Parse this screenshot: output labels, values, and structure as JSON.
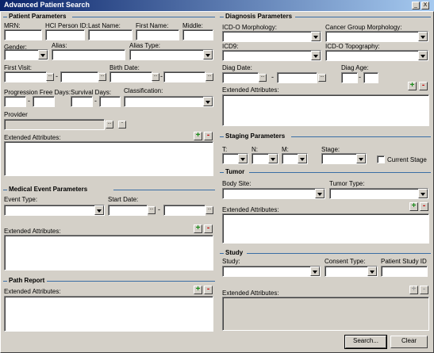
{
  "window": {
    "title": "Advanced Patient Search",
    "minimize_label": "_",
    "close_label": "X"
  },
  "patient": {
    "title": "Patient Parameters",
    "mrn": "MRN:",
    "hci_person_id": "HCI Person ID:",
    "last_name": "Last Name:",
    "first_name": "First Name:",
    "middle": "Middle:",
    "gender": "Gender:",
    "alias": "Alias:",
    "alias_type": "Alias Type:",
    "first_visit": "First Visit:",
    "birth_date": "Birth Date:",
    "progression_free_days": "Progression Free Days:",
    "survival_days": "Survival Days:",
    "classification": "Classification:",
    "provider": "Provider",
    "extended_attributes": "Extended Attributes:"
  },
  "medical_event": {
    "title": "Medical Event Parameters",
    "event_type": "Event Type:",
    "start_date": "Start Date:",
    "extended_attributes": "Extended Attributes:"
  },
  "path_report": {
    "title": "Path Report",
    "extended_attributes": "Extended Attributes:"
  },
  "diagnosis": {
    "title": "Diagnosis Parameters",
    "icdo_morphology": "ICD-O Morphology:",
    "cancer_group_morphology": "Cancer Group Morphology:",
    "icd9": "ICD9:",
    "icdo_topography": "ICD-O Topography:",
    "diag_date": "Diag Date:",
    "diag_age": "Diag Age:",
    "extended_attributes": "Extended Attributes:"
  },
  "staging": {
    "title": "Staging Parameters",
    "t": "T:",
    "n": "N:",
    "m": "M:",
    "stage": "Stage:",
    "current_stage": "Current Stage"
  },
  "tumor": {
    "title": "Tumor",
    "body_site": "Body Site:",
    "tumor_type": "Tumor Type:",
    "extended_attributes": "Extended Attributes:"
  },
  "study": {
    "title": "Study",
    "study": "Study:",
    "consent_type": "Consent Type:",
    "patient_study_id": "Patient Study ID",
    "extended_attributes": "Extended Attributes:"
  },
  "buttons": {
    "search": "Search...",
    "clear": "Clear",
    "dots": "...",
    "dash": "-",
    "plus": "+",
    "minus": "-"
  }
}
